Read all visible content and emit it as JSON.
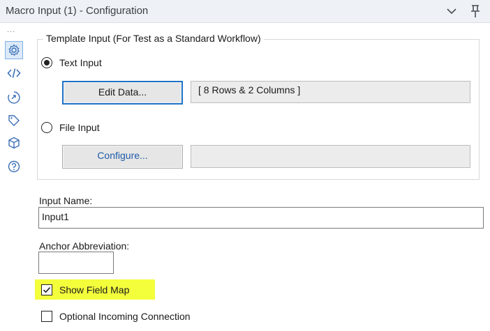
{
  "window": {
    "title": "Macro Input (1) - Configuration",
    "icons": [
      "chevron-down-icon",
      "pin-icon"
    ]
  },
  "sidebar": {
    "more_glyph": "...",
    "items": [
      {
        "icon": "gear-icon",
        "active": true
      },
      {
        "icon": "code-icon",
        "active": false
      },
      {
        "icon": "connection-icon",
        "active": false
      },
      {
        "icon": "tag-icon",
        "active": false
      },
      {
        "icon": "cube-icon",
        "active": false
      },
      {
        "icon": "help-icon",
        "active": false
      }
    ]
  },
  "template_input": {
    "legend": "Template Input (For Test as a Standard Workflow)",
    "text_input_label": "Text Input",
    "text_input_selected": true,
    "edit_data_label": "Edit Data...",
    "data_summary": "[ 8 Rows & 2 Columns ]",
    "file_input_label": "File Input",
    "file_input_selected": false,
    "configure_label": "Configure...",
    "file_path": ""
  },
  "input_name": {
    "label": "Input Name:",
    "value": "Input1"
  },
  "anchor_abbreviation": {
    "label": "Anchor Abbreviation:",
    "value": ""
  },
  "options": {
    "show_field_map_label": "Show Field Map",
    "show_field_map_checked": true,
    "optional_incoming_label": "Optional Incoming Connection",
    "optional_incoming_checked": false
  },
  "colors": {
    "highlight": "#f4ff3c",
    "accent": "#1e73c8",
    "sidebar_active": "#dbe9f8"
  }
}
